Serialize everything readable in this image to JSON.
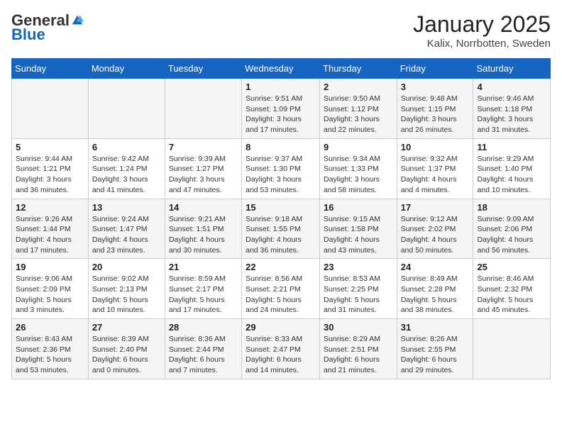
{
  "header": {
    "logo_general": "General",
    "logo_blue": "Blue",
    "month_title": "January 2025",
    "location": "Kalix, Norrbotten, Sweden"
  },
  "weekdays": [
    "Sunday",
    "Monday",
    "Tuesday",
    "Wednesday",
    "Thursday",
    "Friday",
    "Saturday"
  ],
  "weeks": [
    [
      {
        "day": "",
        "info": ""
      },
      {
        "day": "",
        "info": ""
      },
      {
        "day": "",
        "info": ""
      },
      {
        "day": "1",
        "info": "Sunrise: 9:51 AM\nSunset: 1:09 PM\nDaylight: 3 hours\nand 17 minutes."
      },
      {
        "day": "2",
        "info": "Sunrise: 9:50 AM\nSunset: 1:12 PM\nDaylight: 3 hours\nand 22 minutes."
      },
      {
        "day": "3",
        "info": "Sunrise: 9:48 AM\nSunset: 1:15 PM\nDaylight: 3 hours\nand 26 minutes."
      },
      {
        "day": "4",
        "info": "Sunrise: 9:46 AM\nSunset: 1:18 PM\nDaylight: 3 hours\nand 31 minutes."
      }
    ],
    [
      {
        "day": "5",
        "info": "Sunrise: 9:44 AM\nSunset: 1:21 PM\nDaylight: 3 hours\nand 36 minutes."
      },
      {
        "day": "6",
        "info": "Sunrise: 9:42 AM\nSunset: 1:24 PM\nDaylight: 3 hours\nand 41 minutes."
      },
      {
        "day": "7",
        "info": "Sunrise: 9:39 AM\nSunset: 1:27 PM\nDaylight: 3 hours\nand 47 minutes."
      },
      {
        "day": "8",
        "info": "Sunrise: 9:37 AM\nSunset: 1:30 PM\nDaylight: 3 hours\nand 53 minutes."
      },
      {
        "day": "9",
        "info": "Sunrise: 9:34 AM\nSunset: 1:33 PM\nDaylight: 3 hours\nand 58 minutes."
      },
      {
        "day": "10",
        "info": "Sunrise: 9:32 AM\nSunset: 1:37 PM\nDaylight: 4 hours\nand 4 minutes."
      },
      {
        "day": "11",
        "info": "Sunrise: 9:29 AM\nSunset: 1:40 PM\nDaylight: 4 hours\nand 10 minutes."
      }
    ],
    [
      {
        "day": "12",
        "info": "Sunrise: 9:26 AM\nSunset: 1:44 PM\nDaylight: 4 hours\nand 17 minutes."
      },
      {
        "day": "13",
        "info": "Sunrise: 9:24 AM\nSunset: 1:47 PM\nDaylight: 4 hours\nand 23 minutes."
      },
      {
        "day": "14",
        "info": "Sunrise: 9:21 AM\nSunset: 1:51 PM\nDaylight: 4 hours\nand 30 minutes."
      },
      {
        "day": "15",
        "info": "Sunrise: 9:18 AM\nSunset: 1:55 PM\nDaylight: 4 hours\nand 36 minutes."
      },
      {
        "day": "16",
        "info": "Sunrise: 9:15 AM\nSunset: 1:58 PM\nDaylight: 4 hours\nand 43 minutes."
      },
      {
        "day": "17",
        "info": "Sunrise: 9:12 AM\nSunset: 2:02 PM\nDaylight: 4 hours\nand 50 minutes."
      },
      {
        "day": "18",
        "info": "Sunrise: 9:09 AM\nSunset: 2:06 PM\nDaylight: 4 hours\nand 56 minutes."
      }
    ],
    [
      {
        "day": "19",
        "info": "Sunrise: 9:06 AM\nSunset: 2:09 PM\nDaylight: 5 hours\nand 3 minutes."
      },
      {
        "day": "20",
        "info": "Sunrise: 9:02 AM\nSunset: 2:13 PM\nDaylight: 5 hours\nand 10 minutes."
      },
      {
        "day": "21",
        "info": "Sunrise: 8:59 AM\nSunset: 2:17 PM\nDaylight: 5 hours\nand 17 minutes."
      },
      {
        "day": "22",
        "info": "Sunrise: 8:56 AM\nSunset: 2:21 PM\nDaylight: 5 hours\nand 24 minutes."
      },
      {
        "day": "23",
        "info": "Sunrise: 8:53 AM\nSunset: 2:25 PM\nDaylight: 5 hours\nand 31 minutes."
      },
      {
        "day": "24",
        "info": "Sunrise: 8:49 AM\nSunset: 2:28 PM\nDaylight: 5 hours\nand 38 minutes."
      },
      {
        "day": "25",
        "info": "Sunrise: 8:46 AM\nSunset: 2:32 PM\nDaylight: 5 hours\nand 45 minutes."
      }
    ],
    [
      {
        "day": "26",
        "info": "Sunrise: 8:43 AM\nSunset: 2:36 PM\nDaylight: 5 hours\nand 53 minutes."
      },
      {
        "day": "27",
        "info": "Sunrise: 8:39 AM\nSunset: 2:40 PM\nDaylight: 6 hours\nand 0 minutes."
      },
      {
        "day": "28",
        "info": "Sunrise: 8:36 AM\nSunset: 2:44 PM\nDaylight: 6 hours\nand 7 minutes."
      },
      {
        "day": "29",
        "info": "Sunrise: 8:33 AM\nSunset: 2:47 PM\nDaylight: 6 hours\nand 14 minutes."
      },
      {
        "day": "30",
        "info": "Sunrise: 8:29 AM\nSunset: 2:51 PM\nDaylight: 6 hours\nand 21 minutes."
      },
      {
        "day": "31",
        "info": "Sunrise: 8:26 AM\nSunset: 2:55 PM\nDaylight: 6 hours\nand 29 minutes."
      },
      {
        "day": "",
        "info": ""
      }
    ]
  ]
}
